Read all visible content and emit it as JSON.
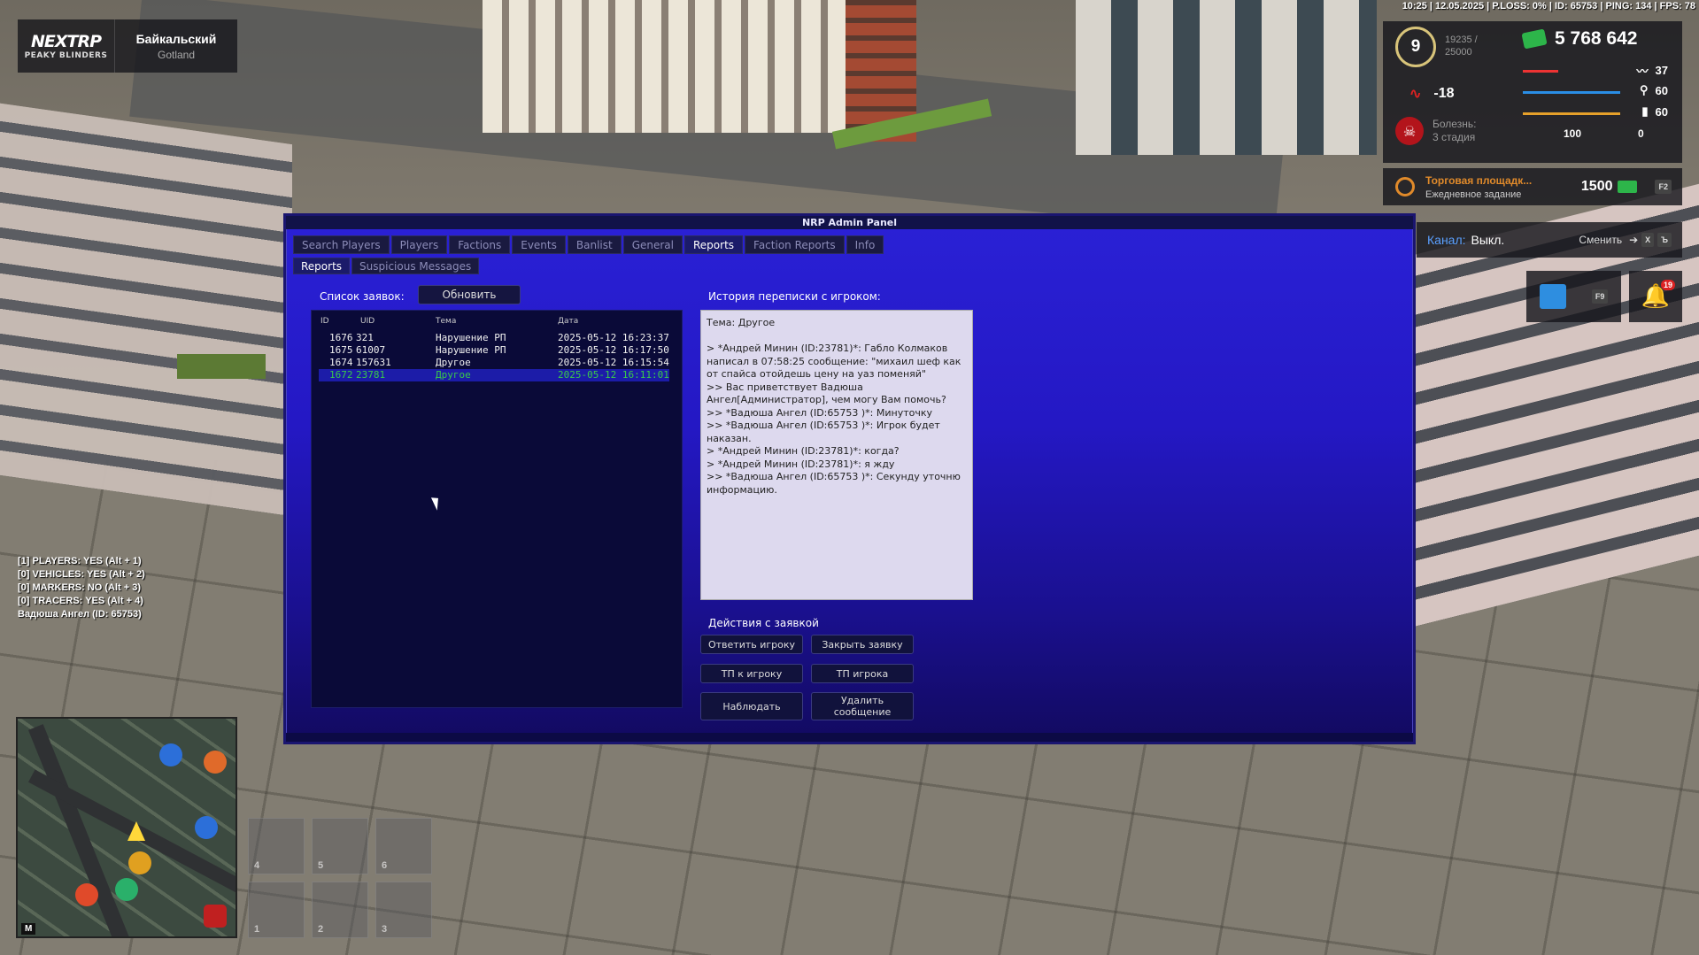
{
  "hud": {
    "logo_main": "NEXTRP",
    "logo_sub": "PEAKY BLINDERS",
    "server_name": "Байкальский",
    "server_sub": "Gotland",
    "status_line": "10:25 | 12.05.2025 | P.LOSS: 0% | ID: 65753 | PING: 134 | FPS: 78",
    "level": "9",
    "exp_current": "19235 /",
    "exp_total": "25000",
    "money": "5 768 642",
    "health": "37",
    "hunger": "60",
    "thirst": "60",
    "armor": "100",
    "shield": "0",
    "rating": "-18",
    "disease_label": "Болезнь:",
    "disease_stage": "3 стадия",
    "task_title": "Торговая площадк...",
    "task_sub": "Ежедневное задание",
    "task_reward": "1500",
    "task_key": "F2",
    "channel_label": "Канал:",
    "channel_value": "Выкл.",
    "channel_switch": "Сменить",
    "channel_key1": "X",
    "channel_key2": "Ъ",
    "calendar_key": "F9",
    "notif_count": "19",
    "colors": {
      "panel": "#2a21d6",
      "money_icon": "#2db54a",
      "selected_row": "#39c94a",
      "task_accent": "#e08a2a"
    }
  },
  "debug_lines": [
    "[1] PLAYERS: YES (Alt + 1)",
    "[0] VEHICLES: YES (Alt + 2)",
    "[0] MARKERS: NO (Alt + 3)",
    "[0] TRACERS: YES (Alt + 4)",
    "Вадюша Ангел (ID: 65753)"
  ],
  "minimap": {
    "key": "M"
  },
  "hotbar": [
    "4",
    "5",
    "6",
    "1",
    "2",
    "3"
  ],
  "panel": {
    "title": "NRP Admin Panel",
    "tabs": [
      "Search Players",
      "Players",
      "Factions",
      "Events",
      "Banlist",
      "General",
      "Reports",
      "Faction Reports",
      "Info"
    ],
    "subtabs": [
      "Reports",
      "Suspicious Messages"
    ],
    "list_label": "Список заявок:",
    "refresh_label": "Обновить",
    "columns": [
      "ID",
      "UID",
      "Тема",
      "Дата"
    ],
    "rows": [
      {
        "id": "1676",
        "uid": "321",
        "topic": "Нарушение РП",
        "date": "2025-05-12 16:23:37"
      },
      {
        "id": "1675",
        "uid": "61007",
        "topic": "Нарушение РП",
        "date": "2025-05-12 16:17:50"
      },
      {
        "id": "1674",
        "uid": "157631",
        "topic": "Другое",
        "date": "2025-05-12 16:15:54"
      },
      {
        "id": "1672",
        "uid": "23781",
        "topic": "Другое",
        "date": "2025-05-12 16:11:01"
      }
    ],
    "history_label": "История переписки с игроком:",
    "history_text": "Тема: Другое\n\n> *Андрей Минин (ID:23781)*: Габло Колмаков написал в 07:58:25 сообщение: \"михаил шеф как от спайса отойдешь цену на уаз поменяй\"\n>> Вас приветствует Вадюша Ангел[Администратор], чем могу Вам помочь?\n>> *Вадюша Ангел (ID:65753 )*: Минуточку\n>> *Вадюша Ангел (ID:65753 )*: Игрок будет наказан.\n> *Андрей Минин (ID:23781)*: когда?\n> *Андрей Минин (ID:23781)*: я жду\n>> *Вадюша Ангел (ID:65753 )*: Секунду уточню информацию.",
    "actions_label": "Действия с заявкой",
    "actions": [
      "Ответить игроку",
      "Закрыть заявку",
      "ТП к игроку",
      "ТП игрока",
      "Наблюдать",
      "Удалить сообщение"
    ]
  }
}
